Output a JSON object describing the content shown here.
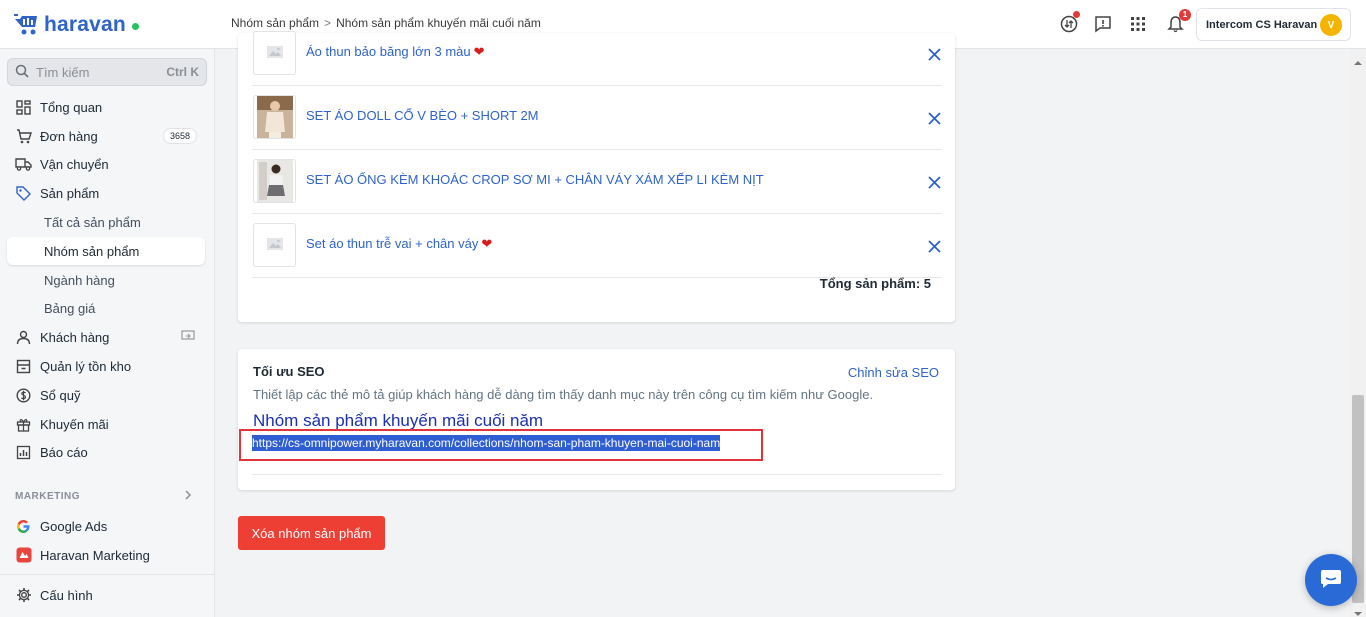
{
  "app": {
    "logo_text": "haravan"
  },
  "breadcrumb": {
    "parent": "Nhóm sản phẩm",
    "separator": ">",
    "current": "Nhóm sản phẩm khuyến mãi cuối năm"
  },
  "header": {
    "notification_count": "1",
    "account_name": "Intercom CS Haravan",
    "avatar_initial": "V"
  },
  "sidebar": {
    "search_placeholder": "Tìm kiếm",
    "search_shortcut": "Ctrl K",
    "items": [
      {
        "label": "Tổng quan",
        "icon": "dashboard-icon"
      },
      {
        "label": "Đơn hàng",
        "icon": "cart-icon",
        "count": "3658"
      },
      {
        "label": "Vận chuyển",
        "icon": "truck-icon"
      },
      {
        "label": "Sản phẩm",
        "icon": "tag-icon"
      },
      {
        "label": "Tất cả sản phẩm"
      },
      {
        "label": "Nhóm sản phẩm"
      },
      {
        "label": "Ngành hàng"
      },
      {
        "label": "Bảng giá"
      },
      {
        "label": "Khách hàng",
        "icon": "customer-icon"
      },
      {
        "label": "Quản lý tồn kho",
        "icon": "inventory-icon"
      },
      {
        "label": "Sổ quỹ",
        "icon": "cashbook-icon"
      },
      {
        "label": "Khuyến mãi",
        "icon": "gift-icon"
      },
      {
        "label": "Báo cáo",
        "icon": "report-icon"
      }
    ],
    "marketing_label": "MARKETING",
    "marketing_items": [
      {
        "label": "Google Ads",
        "icon": "google-icon"
      },
      {
        "label": "Haravan Marketing",
        "icon": "haravan-marketing-icon"
      }
    ],
    "settings_label": "Cấu hình"
  },
  "products": {
    "rows": [
      {
        "name": "Áo thun bảo băng lớn 3 màu",
        "heart": "❤"
      },
      {
        "name": "SET ÁO DOLL CỔ V BÈO + SHORT 2M",
        "heart": ""
      },
      {
        "name": "SET ÁO ỐNG KÈM KHOÁC CROP SƠ MI + CHÂN VÁY XÁM XẾP LI KÈM NỊT",
        "heart": ""
      },
      {
        "name": "Set áo thun trễ vai + chân váy",
        "heart": "❤"
      }
    ],
    "total_label": "Tổng sản phẩm: 5"
  },
  "seo": {
    "title": "Tối ưu SEO",
    "edit_label": "Chỉnh sửa SEO",
    "description": "Thiết lập các thẻ mô tả giúp khách hàng dễ dàng tìm thấy danh mục này trên công cụ tìm kiếm như Google.",
    "preview_title": "Nhóm sản phẩm khuyến mãi cuối năm",
    "preview_url": "https://cs-omnipower.myharavan.com/collections/nhom-san-pham-khuyen-mai-cuoi-nam"
  },
  "actions": {
    "delete_label": "Xóa nhóm sản phẩm"
  },
  "colors": {
    "brand": "#2e63c9",
    "danger": "#ee3f35",
    "highlight": "#e2353b"
  }
}
